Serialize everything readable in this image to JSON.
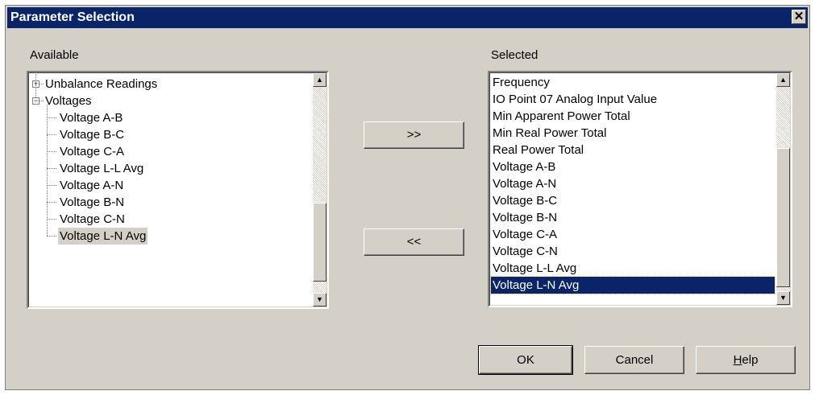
{
  "dialog": {
    "title": "Parameter Selection",
    "close_glyph": "✕"
  },
  "available": {
    "label": "Available",
    "tree": [
      {
        "label": "Unbalance Readings",
        "toggle": "+",
        "level": 0
      },
      {
        "label": "Voltages",
        "toggle": "−",
        "level": 0
      },
      {
        "label": "Voltage A-B",
        "level": 1
      },
      {
        "label": "Voltage B-C",
        "level": 1
      },
      {
        "label": "Voltage C-A",
        "level": 1
      },
      {
        "label": "Voltage L-L Avg",
        "level": 1
      },
      {
        "label": "Voltage A-N",
        "level": 1
      },
      {
        "label": "Voltage B-N",
        "level": 1
      },
      {
        "label": "Voltage C-N",
        "level": 1
      },
      {
        "label": "Voltage L-N Avg",
        "level": 1,
        "selected": true
      }
    ]
  },
  "selected": {
    "label": "Selected",
    "items": [
      "Frequency",
      "IO Point 07 Analog Input Value",
      "Min Apparent Power Total",
      "Min Real Power Total",
      "Real Power Total",
      "Voltage A-B",
      "Voltage A-N",
      "Voltage B-C",
      "Voltage B-N",
      "Voltage C-A",
      "Voltage C-N",
      "Voltage L-L Avg",
      "Voltage L-N Avg"
    ],
    "highlighted_index": 12
  },
  "transfer": {
    "add_label": ">>",
    "remove_label": "<<"
  },
  "buttons": {
    "ok": "OK",
    "cancel": "Cancel",
    "help": "Help"
  },
  "icons": {
    "scroll_up": "▲",
    "scroll_down": "▼"
  },
  "colors": {
    "title_bar": "#0a246a",
    "face": "#d4d0c8",
    "selection": "#0a246a"
  }
}
